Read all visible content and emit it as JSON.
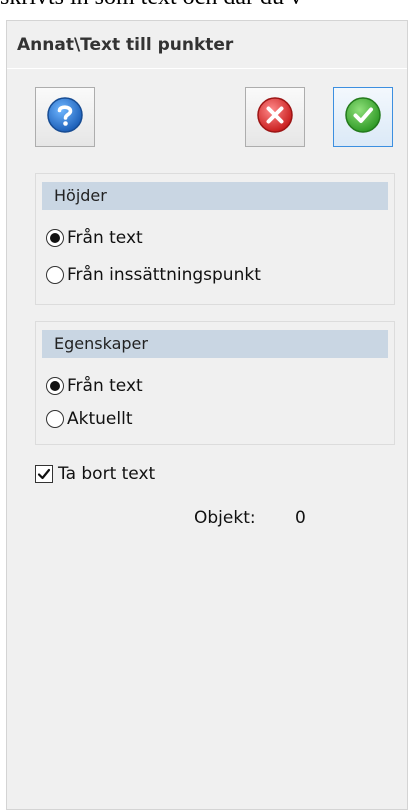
{
  "background_text": "skrivts in som text och där du v",
  "panel": {
    "title": "Annat\\Text till punkter"
  },
  "toolbar": {
    "help_icon": "question-mark-icon",
    "cancel_icon": "red-x-icon",
    "ok_icon": "green-check-icon"
  },
  "heights_group": {
    "header": "Höjder",
    "options": [
      "Från text",
      "Från inssättningspunkt"
    ],
    "selected": "Från text"
  },
  "properties_group": {
    "header": "Egenskaper",
    "options": [
      "Från text",
      "Aktuellt"
    ],
    "selected": "Från text"
  },
  "remove_text": {
    "label": "Ta bort text",
    "checked": true
  },
  "objekt": {
    "label": "Objekt:",
    "value": "0"
  },
  "colors": {
    "header_bg": "#c9d6e3",
    "panel_bg": "#f0f0f0",
    "ok_border": "#3c8fe0"
  }
}
